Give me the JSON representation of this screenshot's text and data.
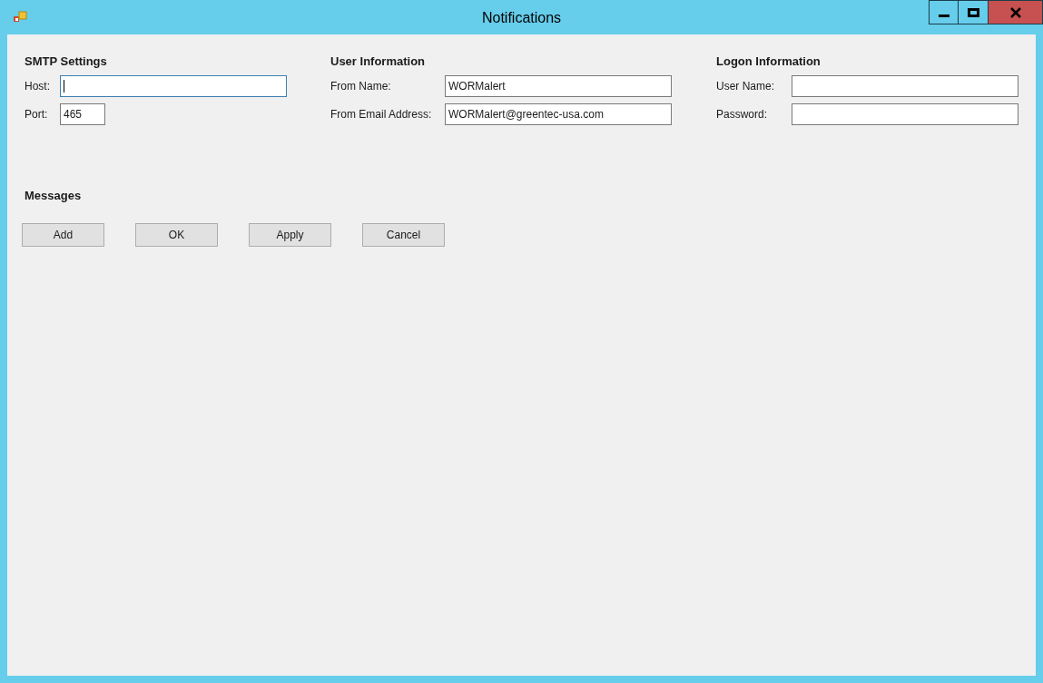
{
  "window": {
    "title": "Notifications"
  },
  "sections": [
    {
      "title": "SMTP Settings",
      "fields": [
        {
          "kind": "wide",
          "label": "Host:",
          "focused": true
        },
        {
          "kind": "short",
          "label": "Port:",
          "value": "465",
          "focused": false
        }
      ]
    },
    {
      "title": "User Information",
      "fields": [
        {
          "kind": "wide",
          "label": "From Name:",
          "value": "WORMalert",
          "focused": false
        },
        {
          "kind": "wide",
          "label": "From Email Address:",
          "value": "WORMalert@greentec-usa.com",
          "focused": false
        }
      ]
    },
    {
      "title": "Logon Information",
      "fields": [
        {
          "kind": "wide",
          "label": "User Name:",
          "focused": false
        },
        {
          "kind": "wide",
          "label": "Password:",
          "focused": false
        }
      ]
    }
  ],
  "messages": {
    "title": "Messages"
  },
  "buttons": [
    "Add",
    "OK",
    "Apply",
    "Cancel"
  ]
}
